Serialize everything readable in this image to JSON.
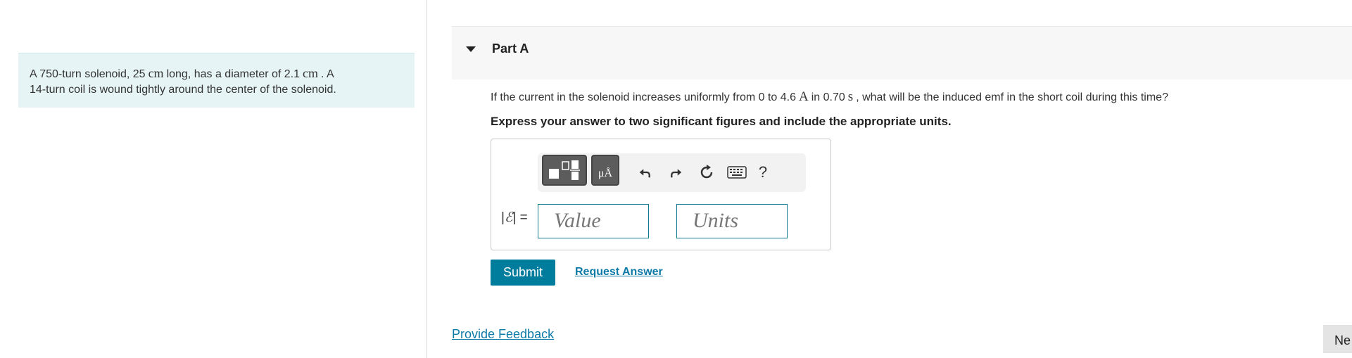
{
  "problem": {
    "text_part1": "A 750-turn solenoid, 25",
    "unit1": "cm",
    "text_part2": "long, has a diameter of 2.1",
    "unit2": "cm",
    "text_part3": ". A",
    "text_line2": "14-turn coil is wound tightly around the center of the solenoid."
  },
  "part": {
    "title": "Part A"
  },
  "question": {
    "text_part1": "If the current in the solenoid increases uniformly from 0 to 4.6",
    "unit_current": "A",
    "text_part2": "in 0.70",
    "unit_time": "s",
    "text_part3": ", what will be the induced emf in the short coil during this time?"
  },
  "instruction": "Express your answer to two significant figures and include the appropriate units.",
  "answer": {
    "label_prefix": "|",
    "label_symbol": "ℰ",
    "label_suffix": "| =",
    "value_placeholder": "Value",
    "units_placeholder": "Units",
    "toolbar": {
      "units_label": "μÅ",
      "undo_icon": "undo-arrow",
      "redo_icon": "redo-arrow",
      "reset_icon": "reset",
      "keyboard_icon": "keyboard",
      "help_label": "?"
    }
  },
  "buttons": {
    "submit": "Submit",
    "request_answer": "Request Answer",
    "provide_feedback": "Provide Feedback",
    "next": "Ne"
  }
}
